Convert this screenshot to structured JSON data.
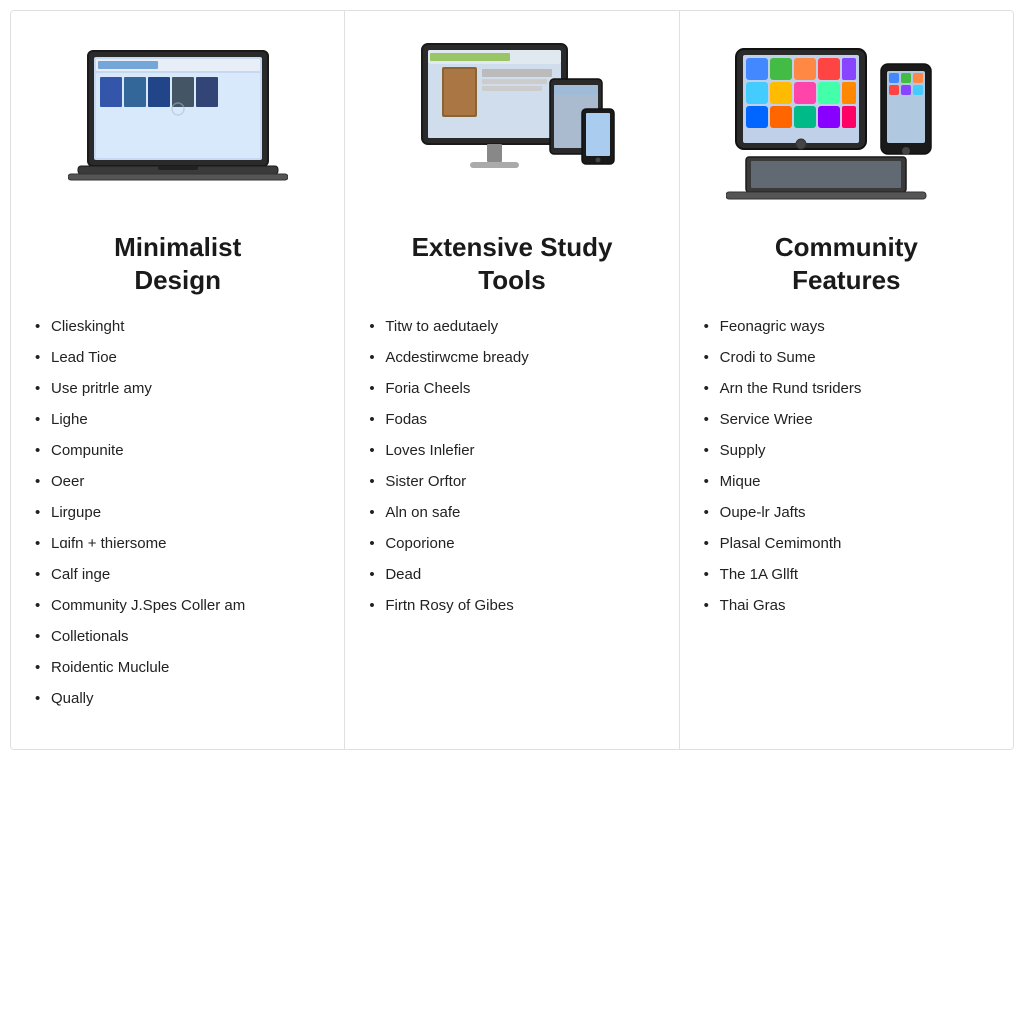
{
  "columns": [
    {
      "id": "minimalist-design",
      "title": "Minimalist\nDesign",
      "device_type": "laptop",
      "features": [
        "Clieskinght",
        "Lead Tioe",
        "Use pritrle amy",
        "Lighe",
        "Compunite",
        "Oeer",
        "Lirgupe",
        "Lɑifn + thiersome",
        "Calf inge",
        "Community J.Spes Coller am",
        "Colletionals",
        "Roidentic Muclule",
        "Qually"
      ]
    },
    {
      "id": "extensive-study-tools",
      "title": "Extensive  Study\nTools",
      "device_type": "desktop",
      "features": [
        "Titw to aedutaely",
        "Acdestirwcme bready",
        "Foria Cheels",
        "Fodas",
        "Loves Inlefier",
        "Sister Orftor",
        "Aln on safe",
        "Coporione",
        "Dead",
        "Firtn Rosy of Gibes"
      ]
    },
    {
      "id": "community-features",
      "title": "Community\nFeatures",
      "device_type": "tablet",
      "features": [
        "Feonagric ways",
        "Crodi to Sume",
        "Arn the Rund tsriders",
        "Service Wriee",
        "Supply",
        "Mique",
        "Oupe-lr Jafts",
        "Plasal Cemimonth",
        "The 1A Gllft",
        "Thai Gras"
      ]
    }
  ]
}
